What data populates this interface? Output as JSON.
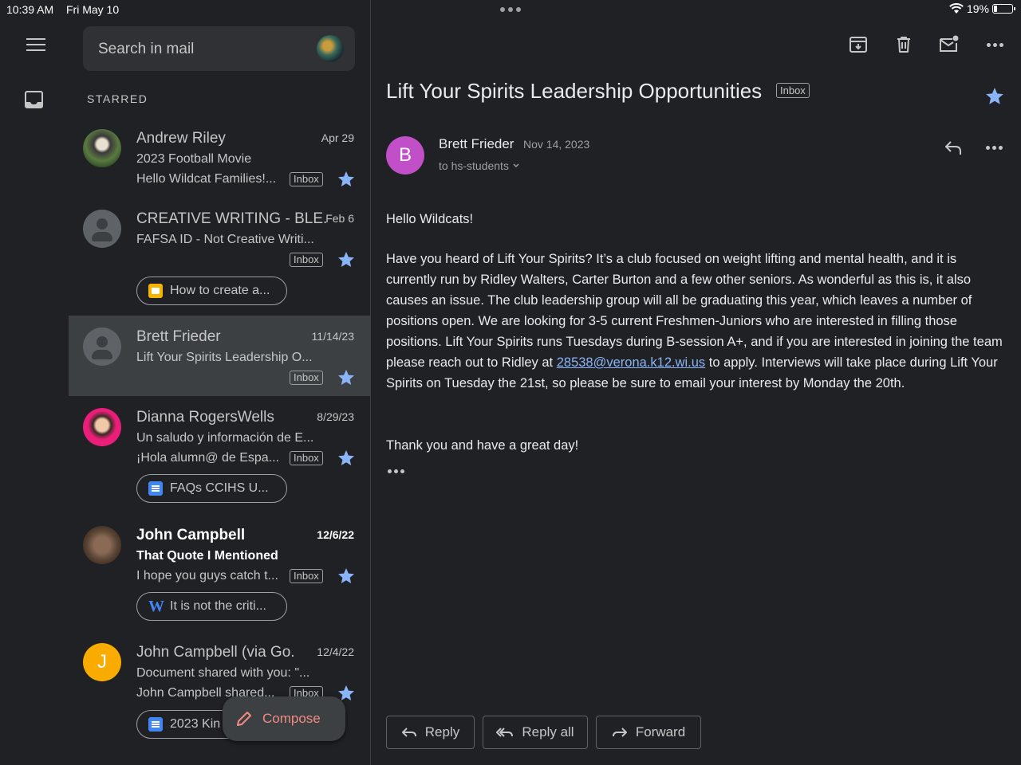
{
  "status_bar": {
    "time": "10:39 AM",
    "date": "Fri May 10",
    "battery": "19%",
    "battery_level": 0.19
  },
  "search": {
    "placeholder": "Search in mail"
  },
  "section_label": "STARRED",
  "mails": [
    {
      "sender": "Andrew Riley",
      "date": "Apr 29",
      "subject": "2023 Football Movie",
      "snippet": "Hello Wildcat Families!...",
      "label": "Inbox",
      "starred": true
    },
    {
      "sender": "CREATIVE WRITING - BLE.",
      "date": "Feb 6",
      "subject": "FAFSA ID - Not Creative Writi...",
      "label": "Inbox",
      "starred": true,
      "attachment": "How to create a..."
    },
    {
      "sender": "Brett Frieder",
      "date": "11/14/23",
      "subject": "Lift Your Spirits Leadership O...",
      "label": "Inbox",
      "starred": true
    },
    {
      "sender": "Dianna RogersWells",
      "date": "8/29/23",
      "subject": "Un saludo y información de E...",
      "snippet": "¡Hola alumn@ de Espa...",
      "label": "Inbox",
      "starred": true,
      "attachment": "FAQs CCIHS U..."
    },
    {
      "sender": "John Campbell",
      "date": "12/6/22",
      "subject": "That Quote I Mentioned",
      "snippet": "I hope you guys catch t...",
      "label": "Inbox",
      "starred": true,
      "attachment": "It is not the criti...",
      "unread": true
    },
    {
      "sender": "John Campbell (via Go.",
      "date": "12/4/22",
      "subject": "Document shared with you: \"...",
      "snippet": "John Campbell shared...",
      "label": "Inbox",
      "starred": true,
      "attachment": "2023 Kin",
      "avatar_letter": "J"
    }
  ],
  "compose_label": "Compose",
  "email": {
    "title": "Lift Your Spirits Leadership Opportunities",
    "label": "Inbox",
    "avatar_letter": "B",
    "from": "Brett Frieder",
    "date": "Nov 14, 2023",
    "to": "to hs-students",
    "greeting": "Hello Wildcats!",
    "para_before_link": "Have you heard of Lift Your Spirits? It’s a club focused on weight lifting and mental health, and it is currently run by Ridley Walters, Carter Burton and a few other seniors. As wonderful as this is, it also causes an issue. The club leadership group will all be graduating this year, which leaves a number of positions open. We are looking for 3-5 current Freshmen-Juniors who are interested in filling those positions. Lift Your Spirits runs Tuesdays during B-session A+, and if you are interested in joining the team please reach out to Ridley at ",
    "link": "28538@verona.k12.wi.us",
    "para_after_link": " to apply. Interviews will take place during Lift Your Spirits on Tuesday the 21st, so please be sure to email your interest by Monday the 20th.",
    "closing": "Thank you and have a great day!"
  },
  "actions": {
    "reply": "Reply",
    "reply_all": "Reply all",
    "forward": "Forward"
  },
  "colors": {
    "background": "#202124",
    "selected": "#3c4043",
    "star": "#8ab4f8",
    "compose": "#f28b82",
    "sender_avatar": "#c14fc7",
    "j_avatar": "#f9ab00"
  }
}
